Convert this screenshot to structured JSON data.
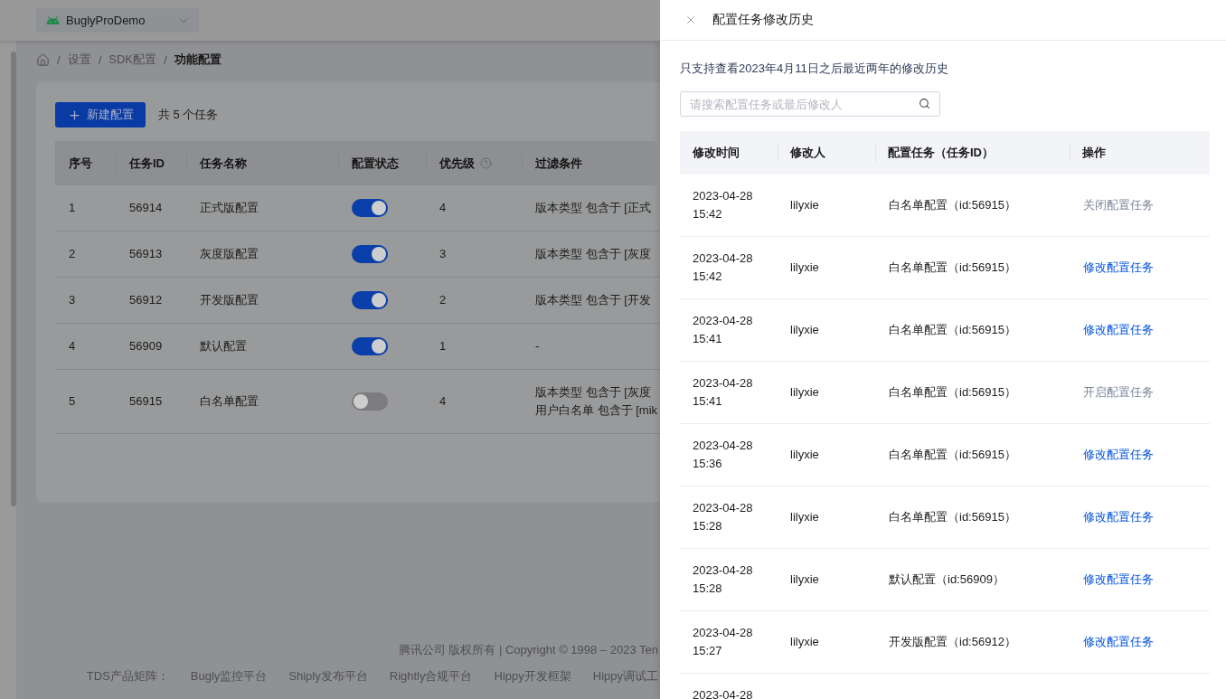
{
  "app_select": {
    "value": "BuglyProDemo"
  },
  "breadcrumb": {
    "items": [
      {
        "separator": "/",
        "label": "设置",
        "current": false
      },
      {
        "separator": "/",
        "label": "SDK配置",
        "current": false
      },
      {
        "separator": "/",
        "label": "功能配置",
        "current": true
      }
    ]
  },
  "toolbar": {
    "new_button": "新建配置",
    "count": "共 5 个任务"
  },
  "task_table": {
    "columns": [
      {
        "label": "序号",
        "help": false
      },
      {
        "label": "任务ID",
        "help": false
      },
      {
        "label": "任务名称",
        "help": false
      },
      {
        "label": "配置状态",
        "help": false
      },
      {
        "label": "优先级",
        "help": true
      },
      {
        "label": "过滤条件",
        "help": false
      }
    ],
    "rows": [
      {
        "index": "1",
        "id": "56914",
        "name": "正式版配置",
        "on": true,
        "priority": "4",
        "filters": [
          "版本类型 包含于 [正式"
        ]
      },
      {
        "index": "2",
        "id": "56913",
        "name": "灰度版配置",
        "on": true,
        "priority": "3",
        "filters": [
          "版本类型 包含于 [灰度"
        ]
      },
      {
        "index": "3",
        "id": "56912",
        "name": "开发版配置",
        "on": true,
        "priority": "2",
        "filters": [
          "版本类型 包含于 [开发"
        ]
      },
      {
        "index": "4",
        "id": "56909",
        "name": "默认配置",
        "on": true,
        "priority": "1",
        "filters": [
          "-"
        ]
      },
      {
        "index": "5",
        "id": "56915",
        "name": "白名单配置",
        "on": false,
        "priority": "4",
        "filters": [
          "版本类型 包含于 [灰度",
          "用户白名单 包含于 [mik"
        ]
      }
    ]
  },
  "footer": {
    "copyright": "腾讯公司 版权所有 | Copyright © 1998 – 2023 Ten",
    "matrix_label": "TDS产品矩阵：",
    "links": [
      "Bugly监控平台",
      "Shiply发布平台",
      "Rightly合规平台",
      "Hippy开发框架",
      "Hippy调试工"
    ]
  },
  "drawer": {
    "title": "配置任务修改历史",
    "notice": "只支持查看2023年4月11日之后最近两年的修改历史",
    "search": {
      "placeholder": "请搜索配置任务或最后修改人"
    },
    "columns": [
      "修改时间",
      "修改人",
      "配置任务（任务ID）",
      "操作"
    ],
    "rows": [
      {
        "time": "2023-04-28 15:42",
        "editor": "lilyxie",
        "task": "白名单配置（id:56915）",
        "action": {
          "label": "关闭配置任务",
          "kind": "text"
        }
      },
      {
        "time": "2023-04-28 15:42",
        "editor": "lilyxie",
        "task": "白名单配置（id:56915）",
        "action": {
          "label": "修改配置任务",
          "kind": "link"
        }
      },
      {
        "time": "2023-04-28 15:41",
        "editor": "lilyxie",
        "task": "白名单配置（id:56915）",
        "action": {
          "label": "修改配置任务",
          "kind": "link"
        }
      },
      {
        "time": "2023-04-28 15:41",
        "editor": "lilyxie",
        "task": "白名单配置（id:56915）",
        "action": {
          "label": "开启配置任务",
          "kind": "text"
        }
      },
      {
        "time": "2023-04-28 15:36",
        "editor": "lilyxie",
        "task": "白名单配置（id:56915）",
        "action": {
          "label": "修改配置任务",
          "kind": "link"
        }
      },
      {
        "time": "2023-04-28 15:28",
        "editor": "lilyxie",
        "task": "白名单配置（id:56915）",
        "action": {
          "label": "修改配置任务",
          "kind": "link"
        }
      },
      {
        "time": "2023-04-28 15:28",
        "editor": "lilyxie",
        "task": "默认配置（id:56909）",
        "action": {
          "label": "修改配置任务",
          "kind": "link"
        }
      },
      {
        "time": "2023-04-28 15:27",
        "editor": "lilyxie",
        "task": "开发版配置（id:56912）",
        "action": {
          "label": "修改配置任务",
          "kind": "link"
        }
      },
      {
        "time": "2023-04-28"
      }
    ]
  }
}
